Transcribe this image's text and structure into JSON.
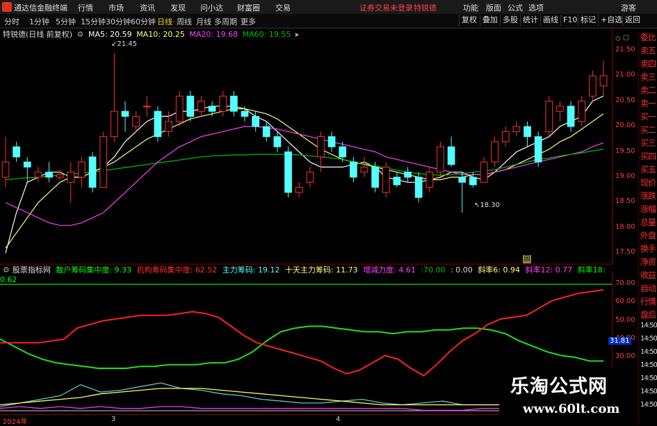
{
  "menubar": {
    "app_title": "通达信金融终端",
    "items": [
      "行情",
      "市场",
      "资讯",
      "发现",
      "问小达",
      "财富圈",
      "交易"
    ],
    "status": "证券交易未登录",
    "stock_name": "特锐德",
    "right_items": [
      "功能",
      "版面",
      "公式",
      "选项",
      "游客"
    ]
  },
  "toolbar": {
    "periods": [
      "分时",
      "1分钟",
      "5分钟",
      "15分钟",
      "30分钟",
      "60分钟",
      "日线",
      "周线",
      "月线",
      "多周期",
      "更多"
    ],
    "active_period": "日线",
    "right_buttons": [
      "复权",
      "叠加",
      "多股",
      "统计",
      "画线",
      "F10",
      "标记",
      "+自选",
      "返回"
    ]
  },
  "info": {
    "title": "特锐德(日线 前复权)",
    "ma5": "MA5: 20.59",
    "ma10": "MA10: 20.25",
    "ma20": "MA20: 19.68",
    "ma60": "MA60: 19.55"
  },
  "price_axis": {
    "labels": [
      "21.50",
      "21.00",
      "20.50",
      "20.00",
      "19.50",
      "19.00",
      "18.50",
      "18.00",
      "17.50"
    ]
  },
  "annotations": {
    "high": "21.45",
    "low": "18.30",
    "badge": "固"
  },
  "indicator": {
    "name": "股票指标网",
    "retail": "散户筹码集中度: 9.33",
    "inst": "机构筹码集中度: 62.52",
    "main": "主力筹码: 19.12",
    "ten": "十天主力筹码: 11.73",
    "force": "增减力度: 4.61",
    "l70": ":70.00",
    "l0": ": 0.00",
    "s6": "斜率6: 0.94",
    "s12": "斜率12: 0.77",
    "s18": "斜率18: 0.62",
    "axis": [
      "70.00",
      "60.00",
      "50.00",
      "40.00",
      "30.00"
    ],
    "readout": "31.81"
  },
  "right_panel": [
    "委比",
    "卖五",
    "卖四",
    "卖三",
    "卖二",
    "卖一",
    "买一",
    "买二",
    "买三",
    "买四",
    "买五",
    "现价",
    "涨跌",
    "涨幅",
    "总量",
    "外盘",
    "换手",
    "净资",
    "收益",
    "自动",
    "行情",
    "盘后",
    "14:50",
    "14:50",
    "14:50",
    "14:50",
    "14:50",
    "14:50",
    "14:50"
  ],
  "xaxis": {
    "labels": [
      "2024年",
      "3",
      "4"
    ]
  },
  "watermark": {
    "title": "乐淘公式网",
    "url": "www.60lt.com"
  },
  "colors": {
    "up": "#ff3030",
    "down": "#54ffff",
    "ma5": "#ffffff",
    "ma10": "#ffff80",
    "ma20": "#ff40ff",
    "ma60": "#00c000"
  },
  "chart_data": {
    "type": "candlestick",
    "ylim": [
      17.3,
      21.7
    ],
    "candles": [
      {
        "o": 19.0,
        "c": 19.3,
        "h": 19.8,
        "l": 18.8
      },
      {
        "o": 19.6,
        "c": 19.4,
        "h": 19.7,
        "l": 19.3
      },
      {
        "o": 19.3,
        "c": 19.2,
        "h": 19.4,
        "l": 18.9
      },
      {
        "o": 19.0,
        "c": 19.1,
        "h": 19.2,
        "l": 18.9
      },
      {
        "o": 19.1,
        "c": 19.0,
        "h": 19.3,
        "l": 18.9
      },
      {
        "o": 19.0,
        "c": 19.05,
        "h": 19.15,
        "l": 18.95
      },
      {
        "o": 18.9,
        "c": 19.1,
        "h": 19.3,
        "l": 18.5
      },
      {
        "o": 19.0,
        "c": 19.3,
        "h": 19.4,
        "l": 18.8
      },
      {
        "o": 19.4,
        "c": 18.8,
        "h": 19.5,
        "l": 18.7
      },
      {
        "o": 18.8,
        "c": 19.8,
        "h": 19.9,
        "l": 18.8
      },
      {
        "o": 19.8,
        "c": 20.3,
        "h": 21.45,
        "l": 19.7
      },
      {
        "o": 20.3,
        "c": 20.2,
        "h": 20.5,
        "l": 19.9
      },
      {
        "o": 20.0,
        "c": 20.2,
        "h": 20.3,
        "l": 19.9
      },
      {
        "o": 20.4,
        "c": 20.4,
        "h": 20.6,
        "l": 20.2
      },
      {
        "o": 20.3,
        "c": 19.8,
        "h": 20.4,
        "l": 19.7
      },
      {
        "o": 19.9,
        "c": 20.1,
        "h": 20.3,
        "l": 19.8
      },
      {
        "o": 20.1,
        "c": 20.6,
        "h": 20.7,
        "l": 20.0
      },
      {
        "o": 20.6,
        "c": 20.2,
        "h": 20.7,
        "l": 20.1
      },
      {
        "o": 20.3,
        "c": 20.5,
        "h": 20.6,
        "l": 20.2
      },
      {
        "o": 20.4,
        "c": 20.3,
        "h": 20.5,
        "l": 20.2
      },
      {
        "o": 20.3,
        "c": 20.6,
        "h": 20.7,
        "l": 20.2
      },
      {
        "o": 20.6,
        "c": 20.3,
        "h": 20.7,
        "l": 20.2
      },
      {
        "o": 20.3,
        "c": 20.2,
        "h": 20.4,
        "l": 20.1
      },
      {
        "o": 20.2,
        "c": 20.0,
        "h": 20.3,
        "l": 19.9
      },
      {
        "o": 20.0,
        "c": 19.8,
        "h": 20.1,
        "l": 19.7
      },
      {
        "o": 19.8,
        "c": 19.6,
        "h": 19.9,
        "l": 19.5
      },
      {
        "o": 19.5,
        "c": 18.7,
        "h": 19.6,
        "l": 18.6
      },
      {
        "o": 18.7,
        "c": 18.8,
        "h": 18.9,
        "l": 18.6
      },
      {
        "o": 18.9,
        "c": 19.1,
        "h": 19.2,
        "l": 18.8
      },
      {
        "o": 19.4,
        "c": 19.8,
        "h": 19.9,
        "l": 19.1
      },
      {
        "o": 19.8,
        "c": 19.6,
        "h": 19.9,
        "l": 19.5
      },
      {
        "o": 19.6,
        "c": 19.4,
        "h": 19.7,
        "l": 19.3
      },
      {
        "o": 19.3,
        "c": 19.0,
        "h": 19.4,
        "l": 18.9
      },
      {
        "o": 19.1,
        "c": 19.2,
        "h": 19.4,
        "l": 19.0
      },
      {
        "o": 19.2,
        "c": 18.8,
        "h": 19.3,
        "l": 18.7
      },
      {
        "o": 18.7,
        "c": 19.2,
        "h": 19.3,
        "l": 18.6
      },
      {
        "o": 19.0,
        "c": 18.85,
        "h": 19.1,
        "l": 18.8
      },
      {
        "o": 19.1,
        "c": 19.0,
        "h": 19.2,
        "l": 18.9
      },
      {
        "o": 19.0,
        "c": 18.6,
        "h": 19.1,
        "l": 18.5
      },
      {
        "o": 18.8,
        "c": 19.1,
        "h": 19.2,
        "l": 18.7
      },
      {
        "o": 19.1,
        "c": 19.6,
        "h": 19.7,
        "l": 19.0
      },
      {
        "o": 19.6,
        "c": 19.25,
        "h": 19.8,
        "l": 19.2
      },
      {
        "o": 19.0,
        "c": 18.9,
        "h": 19.1,
        "l": 18.3
      },
      {
        "o": 19.0,
        "c": 18.85,
        "h": 19.1,
        "l": 18.8
      },
      {
        "o": 18.9,
        "c": 19.3,
        "h": 19.4,
        "l": 18.9
      },
      {
        "o": 19.3,
        "c": 19.7,
        "h": 19.8,
        "l": 19.2
      },
      {
        "o": 19.7,
        "c": 19.9,
        "h": 20.0,
        "l": 19.6
      },
      {
        "o": 19.9,
        "c": 20.0,
        "h": 20.1,
        "l": 19.8
      },
      {
        "o": 20.0,
        "c": 19.8,
        "h": 20.1,
        "l": 19.6
      },
      {
        "o": 19.8,
        "c": 19.3,
        "h": 19.9,
        "l": 19.2
      },
      {
        "o": 19.9,
        "c": 20.5,
        "h": 20.6,
        "l": 19.8
      },
      {
        "o": 20.3,
        "c": 20.4,
        "h": 20.5,
        "l": 20.1
      },
      {
        "o": 20.4,
        "c": 20.0,
        "h": 20.5,
        "l": 19.9
      },
      {
        "o": 20.1,
        "c": 20.5,
        "h": 20.6,
        "l": 20.0
      },
      {
        "o": 20.6,
        "c": 21.0,
        "h": 21.1,
        "l": 20.5
      },
      {
        "o": 20.8,
        "c": 21.0,
        "h": 21.3,
        "l": 20.6
      }
    ],
    "ma_series": {
      "ma5": [
        17.5,
        18.3,
        18.9,
        19.0,
        19.1,
        19.1,
        19.0,
        19.0,
        19.1,
        19.2,
        19.4,
        19.7,
        19.9,
        20.1,
        20.2,
        20.2,
        20.3,
        20.3,
        20.35,
        20.4,
        20.4,
        20.4,
        20.35,
        20.2,
        20.1,
        19.9,
        19.7,
        19.5,
        19.3,
        19.2,
        19.2,
        19.2,
        19.25,
        19.3,
        19.2,
        19.0,
        18.95,
        18.9,
        18.9,
        18.95,
        19.0,
        19.1,
        19.1,
        19.0,
        18.95,
        19.1,
        19.3,
        19.5,
        19.6,
        19.7,
        19.8,
        20.0,
        20.1,
        20.2,
        20.5,
        20.6
      ],
      "ma10": [
        17.6,
        17.9,
        18.2,
        18.5,
        18.7,
        18.9,
        19.0,
        19.0,
        19.1,
        19.2,
        19.3,
        19.45,
        19.6,
        19.75,
        19.85,
        19.95,
        20.05,
        20.15,
        20.2,
        20.25,
        20.3,
        20.35,
        20.35,
        20.3,
        20.25,
        20.15,
        20.0,
        19.85,
        19.7,
        19.55,
        19.45,
        19.35,
        19.3,
        19.25,
        19.2,
        19.15,
        19.1,
        19.05,
        19.0,
        18.95,
        18.95,
        19.0,
        19.0,
        19.05,
        19.05,
        19.1,
        19.15,
        19.25,
        19.35,
        19.45,
        19.55,
        19.7,
        19.8,
        19.95,
        20.1,
        20.25
      ],
      "ma20": [
        18.5,
        18.4,
        18.3,
        18.2,
        18.1,
        18.05,
        18.05,
        18.1,
        18.2,
        18.3,
        18.5,
        18.7,
        18.9,
        19.1,
        19.3,
        19.45,
        19.6,
        19.7,
        19.8,
        19.85,
        19.9,
        19.95,
        20.0,
        20.0,
        19.98,
        19.95,
        19.9,
        19.85,
        19.8,
        19.75,
        19.7,
        19.65,
        19.6,
        19.55,
        19.5,
        19.4,
        19.35,
        19.3,
        19.25,
        19.2,
        19.15,
        19.1,
        19.05,
        19.05,
        19.05,
        19.1,
        19.15,
        19.2,
        19.25,
        19.3,
        19.35,
        19.4,
        19.45,
        19.5,
        19.6,
        19.68
      ],
      "ma60": [
        18.95,
        18.97,
        18.99,
        19.0,
        19.02,
        19.04,
        19.06,
        19.08,
        19.1,
        19.13,
        19.16,
        19.19,
        19.22,
        19.25,
        19.28,
        19.31,
        19.34,
        19.37,
        19.4,
        19.42,
        19.43,
        19.44,
        19.44,
        19.45,
        19.45,
        19.45,
        19.45,
        19.44,
        19.42,
        19.4,
        19.38,
        19.35,
        19.3,
        19.26,
        19.22,
        19.18,
        19.14,
        19.1,
        19.07,
        19.05,
        19.04,
        19.05,
        19.07,
        19.1,
        19.12,
        19.15,
        19.2,
        19.25,
        19.3,
        19.35,
        19.38,
        19.42,
        19.45,
        19.48,
        19.52,
        19.55
      ]
    },
    "ind_ylim": [
      0,
      75
    ],
    "ind_series": {
      "red": [
        38,
        38,
        38,
        38,
        39,
        40,
        46,
        48,
        50,
        51,
        52,
        53,
        53,
        53,
        54,
        55,
        54,
        52,
        47,
        42,
        38,
        36,
        34,
        32,
        30,
        28,
        24,
        21,
        23,
        27,
        31,
        29,
        24,
        20,
        26,
        33,
        39,
        43,
        48,
        51,
        52,
        53,
        57,
        61,
        63,
        65,
        66,
        67
      ],
      "green": [
        40,
        36,
        32,
        29,
        27,
        26,
        25,
        24,
        24,
        24,
        25,
        25,
        26,
        26,
        26,
        27,
        27,
        29,
        33,
        39,
        44,
        46,
        47,
        47,
        46,
        45,
        44,
        44,
        43,
        44,
        44,
        45,
        45,
        46,
        46,
        45,
        43,
        39,
        36,
        33,
        31,
        30,
        28,
        28
      ],
      "yellow": [
        4,
        5,
        6,
        7,
        8,
        10,
        11,
        12,
        13,
        13,
        13,
        12,
        11,
        10,
        9,
        8,
        7,
        6,
        5,
        4,
        4,
        4,
        4,
        4,
        4,
        4,
        4,
        5,
        5,
        5,
        5
      ],
      "cyan": [
        3,
        5,
        7,
        9,
        15,
        11,
        12,
        14,
        16,
        13,
        12,
        10,
        9,
        7,
        6,
        5,
        5,
        6,
        7,
        5,
        4,
        5,
        6,
        4,
        4,
        4,
        4,
        5,
        4,
        4,
        4
      ],
      "magenta": [
        2,
        3,
        2,
        3,
        2,
        3,
        2,
        2,
        3,
        3,
        2,
        2,
        2,
        2,
        2,
        2,
        2,
        2,
        2,
        2,
        2,
        1,
        1,
        1,
        2,
        2,
        2,
        2,
        3,
        3,
        3
      ],
      "level70": 70,
      "level0": 0
    }
  }
}
